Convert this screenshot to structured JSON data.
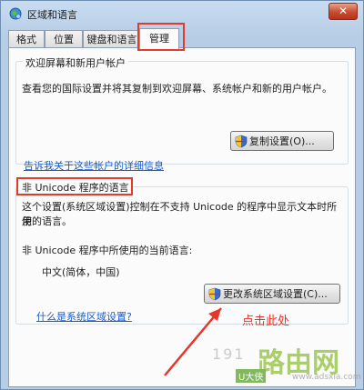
{
  "window": {
    "title": "区域和语言",
    "close_label": "✕"
  },
  "tabs": [
    {
      "label": "格式",
      "active": false
    },
    {
      "label": "位置",
      "active": false
    },
    {
      "label": "键盘和语言",
      "active": false
    },
    {
      "label": "管理",
      "active": true
    }
  ],
  "welcome_group": {
    "title": "欢迎屏幕和新用户帐户",
    "description": "查看您的国际设置并将其复制到欢迎屏幕、系统帐户和新的用户帐户。",
    "copy_button": "复制设置(O)...",
    "link": "告诉我关于这些帐户的详细信息"
  },
  "unicode_group": {
    "title": "非 Unicode 程序的语言",
    "description_line1": "这个设置(系统区域设置)控制在不支持 Unicode 的程序中显示文本时所使",
    "description_line2": "用的语言。",
    "current_label": "非 Unicode 程序中所使用的当前语言:",
    "current_value": "中文(简体，中国)",
    "change_button": "更改系统区域设置(C)...",
    "link": "什么是系统区域设置?"
  },
  "annotation": {
    "text": "点击此处",
    "color": "#e8352a"
  },
  "watermark": {
    "digits": "191",
    "brand": "路由网",
    "badge": "U大侠",
    "site": "www.adsxia.com"
  }
}
